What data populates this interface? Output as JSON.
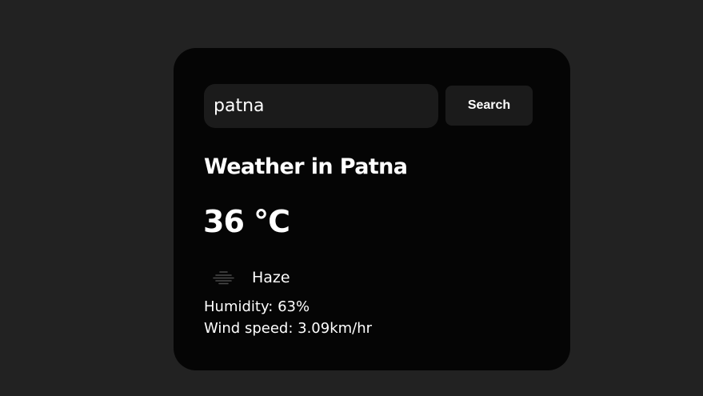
{
  "search": {
    "value": "patna",
    "button_label": "Search"
  },
  "weather": {
    "title": "Weather in Patna",
    "temperature": "36 °C",
    "condition_icon": "haze-icon",
    "description": "Haze",
    "humidity": "Humidity: 63%",
    "wind": "Wind speed: 3.09km/hr"
  },
  "colors": {
    "background": "#222222",
    "card": "#050505",
    "input": "#1b1b1b",
    "text": "#ffffff"
  }
}
